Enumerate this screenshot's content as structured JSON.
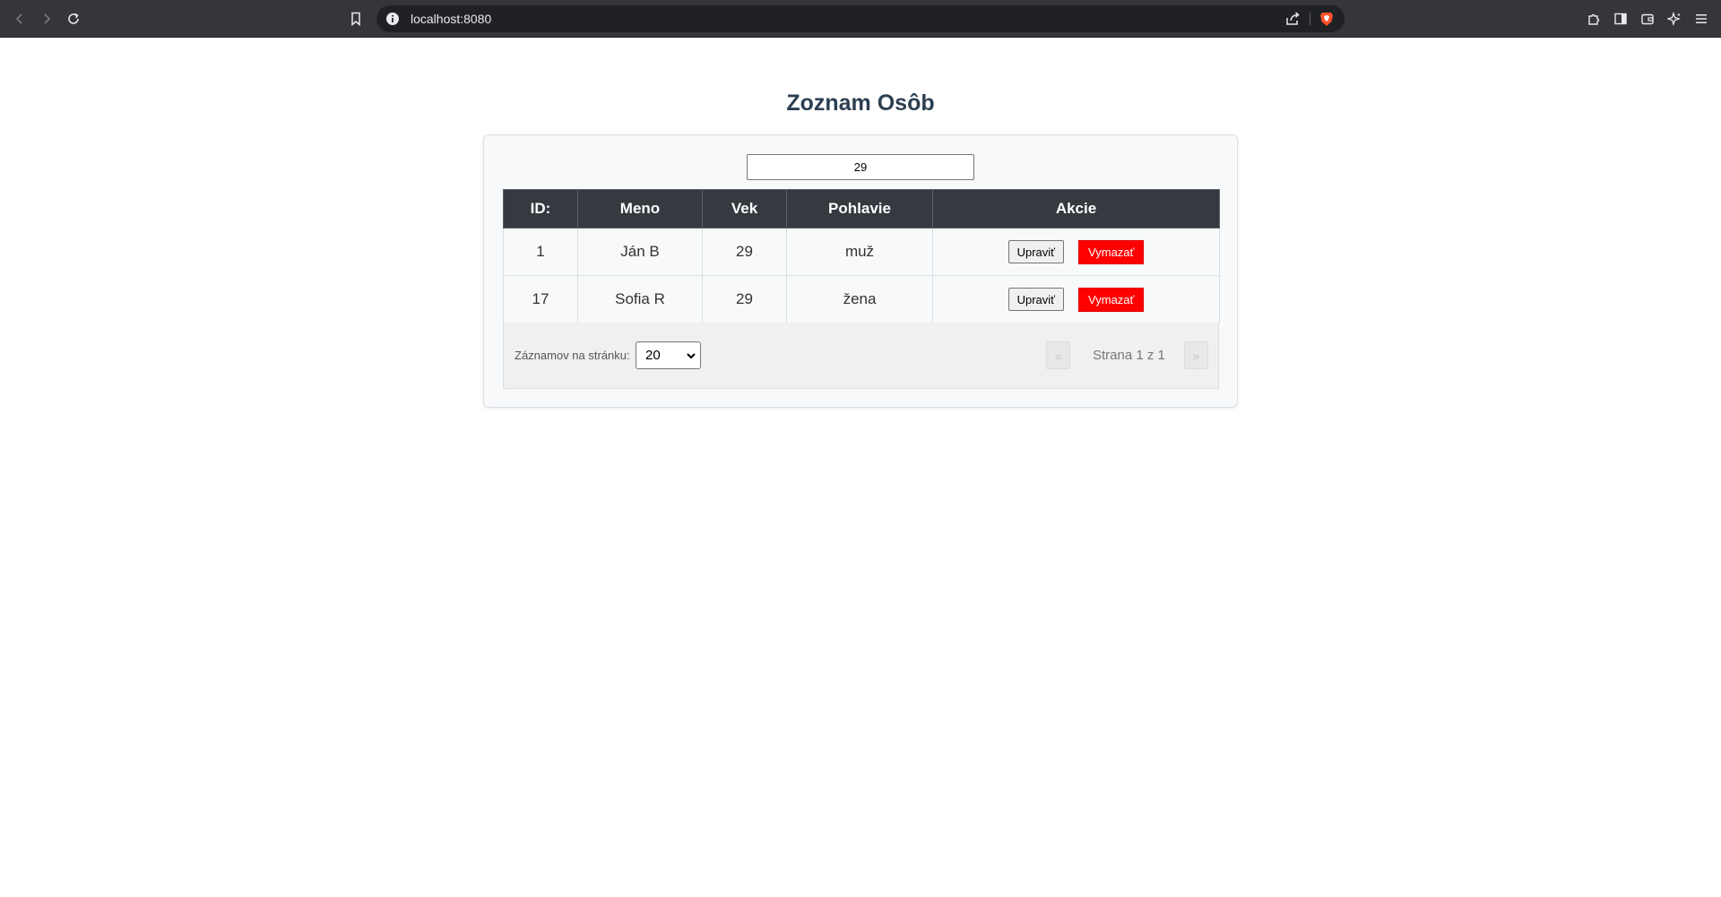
{
  "browser": {
    "url": "localhost:8080",
    "icons": {
      "back": "chevron-left-icon",
      "forward": "chevron-right-icon",
      "reload": "reload-icon",
      "bookmark": "bookmark-icon",
      "site_info": "info-icon",
      "share": "share-icon",
      "brave": "brave-shield-icon",
      "extensions": "puzzle-icon",
      "sidebar": "sidebar-icon",
      "wallet": "wallet-icon",
      "leo": "sparkle-icon",
      "menu": "hamburger-menu-icon"
    }
  },
  "page": {
    "title": "Zoznam Osôb"
  },
  "search": {
    "value": "29"
  },
  "table": {
    "headers": [
      "ID:",
      "Meno",
      "Vek",
      "Pohlavie",
      "Akcie"
    ],
    "rows": [
      {
        "id": "1",
        "name": "Ján B",
        "age": "29",
        "gender": "muž"
      },
      {
        "id": "17",
        "name": "Sofia R",
        "age": "29",
        "gender": "žena"
      }
    ],
    "edit_label": "Upraviť",
    "delete_label": "Vymazať"
  },
  "pagination": {
    "per_page_label": "Záznamov na stránku:",
    "per_page_value": "20",
    "prev_label": "«",
    "next_label": "»",
    "page_info": "Strana 1 z 1"
  },
  "colors": {
    "header_bg": "#343a40",
    "title": "#2c3e50",
    "delete_bg": "#ff0000"
  }
}
